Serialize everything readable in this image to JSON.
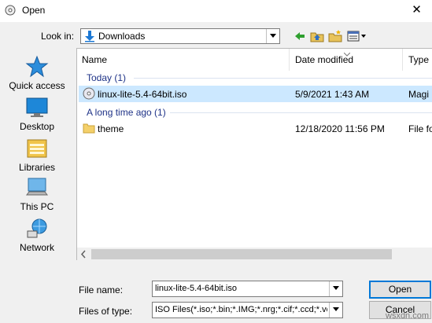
{
  "window": {
    "title": "Open",
    "close_glyph": "✕"
  },
  "lookin": {
    "label": "Look in:",
    "value": "Downloads"
  },
  "places": [
    {
      "label": "Quick access",
      "icon": "star-icon"
    },
    {
      "label": "Desktop",
      "icon": "desktop-icon"
    },
    {
      "label": "Libraries",
      "icon": "libraries-icon"
    },
    {
      "label": "This PC",
      "icon": "computer-icon"
    },
    {
      "label": "Network",
      "icon": "network-icon"
    }
  ],
  "columns": {
    "name": "Name",
    "date": "Date modified",
    "type": "Type"
  },
  "groups": [
    {
      "header": "Today (1)",
      "files": [
        {
          "name": "linux-lite-5.4-64bit.iso",
          "date": "5/9/2021 1:43 AM",
          "type": "Magi",
          "icon": "disc-image-icon",
          "selected": true
        }
      ]
    },
    {
      "header": "A long time ago (1)",
      "files": [
        {
          "name": "theme",
          "date": "12/18/2020 11:56 PM",
          "type": "File fo",
          "icon": "folder-icon",
          "selected": false
        }
      ]
    }
  ],
  "filename": {
    "label": "File name:",
    "value": "linux-lite-5.4-64bit.iso"
  },
  "filetype": {
    "label": "Files of type:",
    "value": "ISO Files(*.iso;*.bin;*.IMG;*.nrg;*.cif;*.ccd;*.vcd"
  },
  "buttons": {
    "open": "Open",
    "cancel": "Cancel"
  },
  "watermark": "wsxdn.com",
  "colors": {
    "selection": "#cce8ff",
    "group_header": "#1e3287",
    "accent": "#0078d7"
  }
}
